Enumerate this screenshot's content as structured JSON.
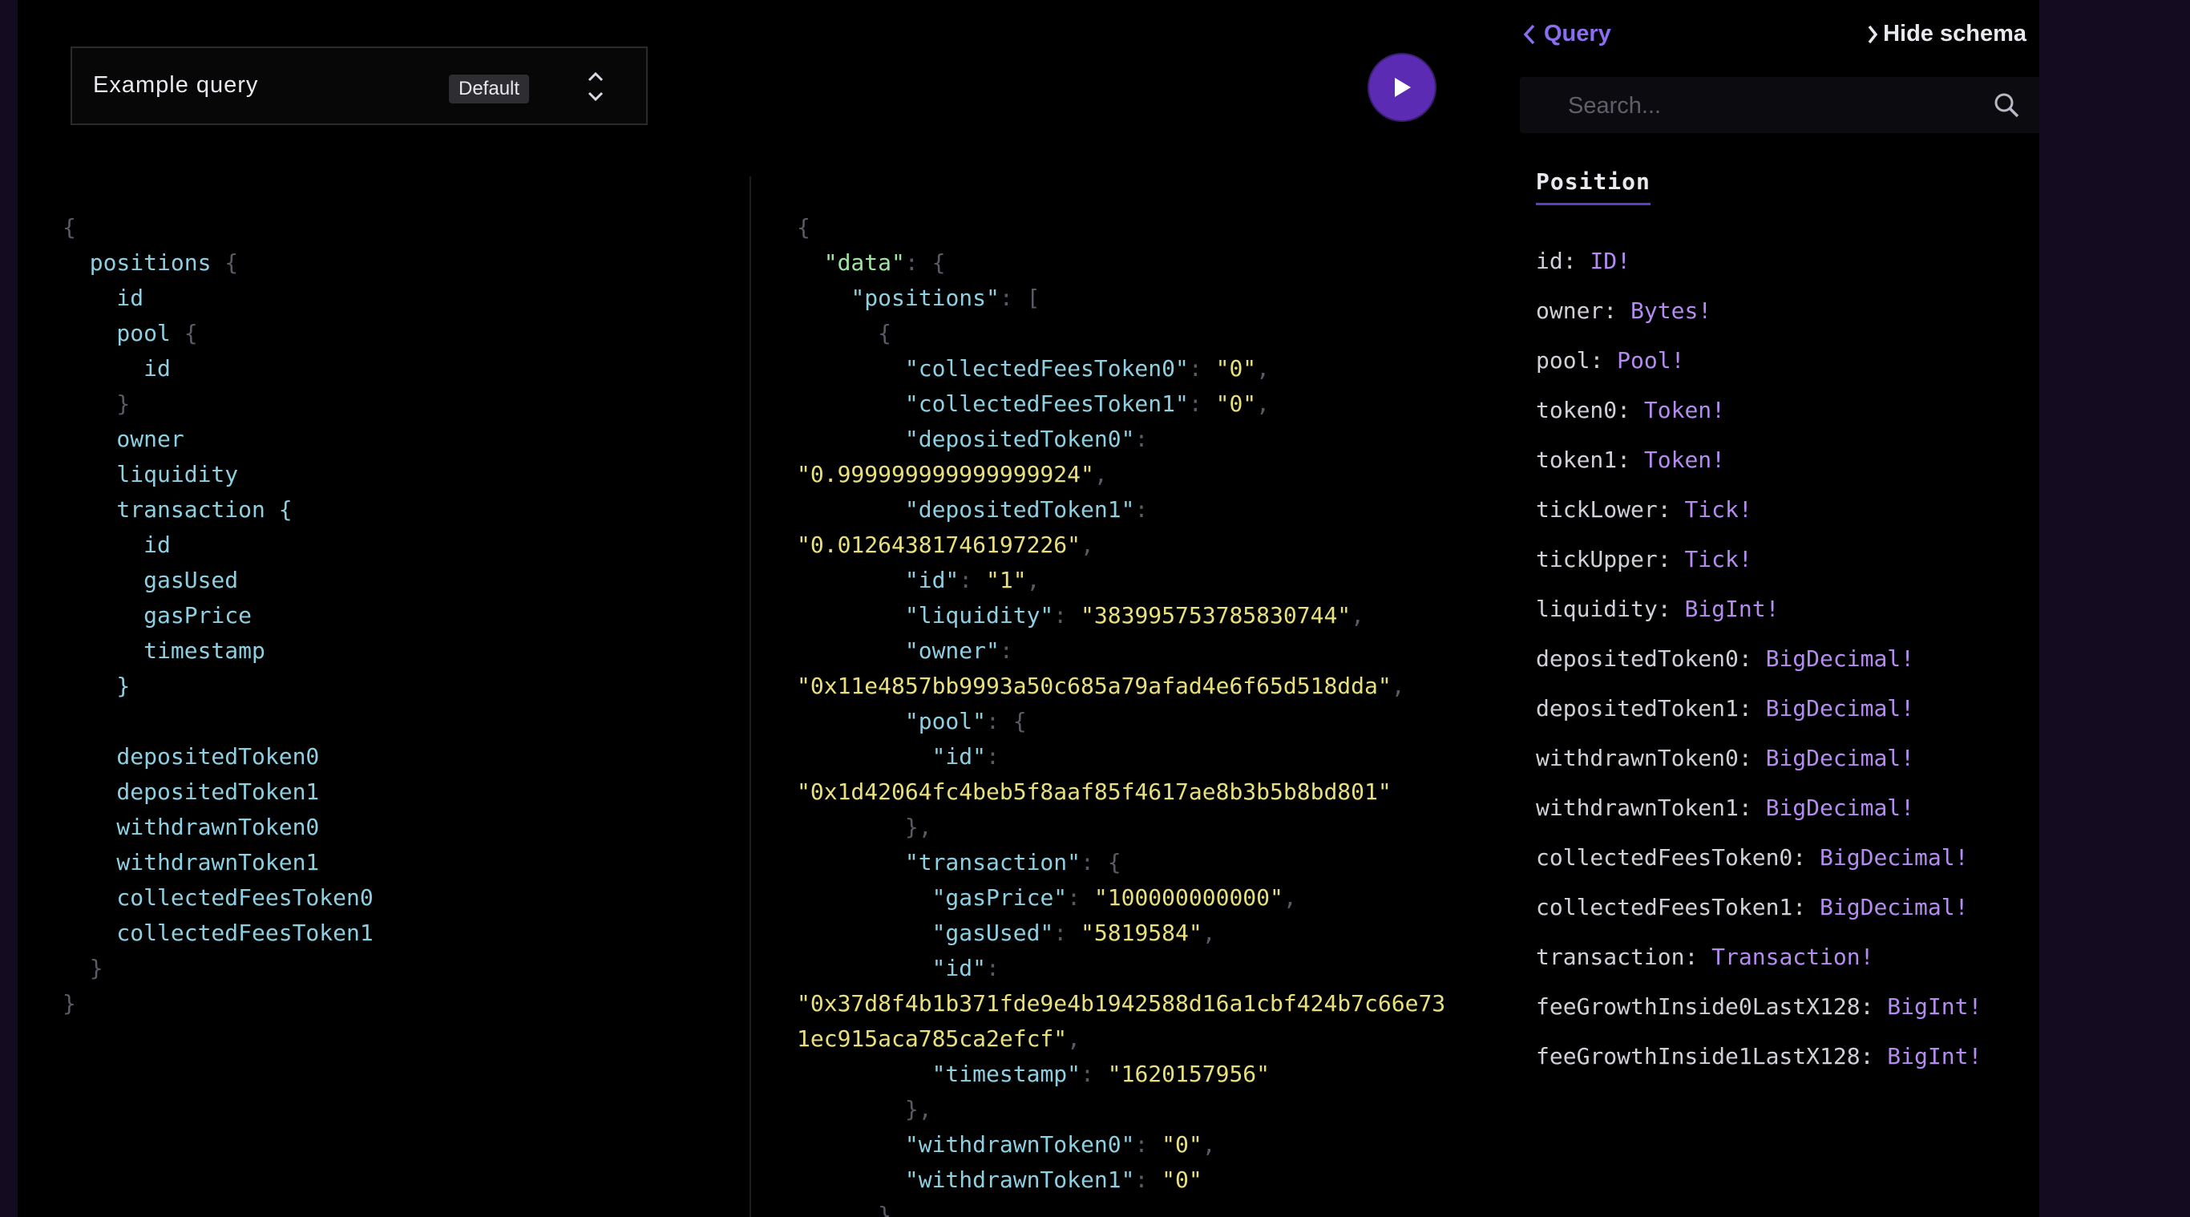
{
  "query_selector": {
    "name": "Example query",
    "badge": "Default"
  },
  "query_lines": [
    [
      {
        "t": "{",
        "c": "brace"
      }
    ],
    [
      {
        "t": "  positions ",
        "c": "field"
      },
      {
        "t": "{",
        "c": "brace"
      }
    ],
    [
      {
        "t": "    id",
        "c": "field"
      }
    ],
    [
      {
        "t": "    pool ",
        "c": "field"
      },
      {
        "t": "{",
        "c": "brace"
      }
    ],
    [
      {
        "t": "      id",
        "c": "field"
      }
    ],
    [
      {
        "t": "    }",
        "c": "brace"
      }
    ],
    [
      {
        "t": "    owner",
        "c": "field"
      }
    ],
    [
      {
        "t": "    liquidity",
        "c": "field"
      }
    ],
    [
      {
        "t": "    transaction ",
        "c": "field"
      },
      {
        "t": "{",
        "c": "field"
      }
    ],
    [
      {
        "t": "      id",
        "c": "field"
      }
    ],
    [
      {
        "t": "      gasUsed",
        "c": "field"
      }
    ],
    [
      {
        "t": "      gasPrice",
        "c": "field"
      }
    ],
    [
      {
        "t": "      timestamp",
        "c": "field"
      }
    ],
    [
      {
        "t": "    }",
        "c": "field"
      }
    ],
    [
      {
        "t": "",
        "c": "field"
      }
    ],
    [
      {
        "t": "    depositedToken0",
        "c": "field"
      }
    ],
    [
      {
        "t": "    depositedToken1",
        "c": "field"
      }
    ],
    [
      {
        "t": "    withdrawnToken0",
        "c": "field"
      }
    ],
    [
      {
        "t": "    withdrawnToken1",
        "c": "field"
      }
    ],
    [
      {
        "t": "    collectedFeesToken0",
        "c": "field"
      }
    ],
    [
      {
        "t": "    collectedFeesToken1",
        "c": "field"
      }
    ],
    [
      {
        "t": "  }",
        "c": "brace"
      }
    ],
    [
      {
        "t": "}",
        "c": "brace"
      }
    ]
  ],
  "result_lines": [
    [
      {
        "t": "{",
        "c": "punc"
      }
    ],
    [
      {
        "t": "  ",
        "c": "punc"
      },
      {
        "t": "\"data\"",
        "c": "topkey"
      },
      {
        "t": ": {",
        "c": "punc"
      }
    ],
    [
      {
        "t": "    ",
        "c": "punc"
      },
      {
        "t": "\"positions\"",
        "c": "key"
      },
      {
        "t": ": [",
        "c": "punc"
      }
    ],
    [
      {
        "t": "      {",
        "c": "punc"
      }
    ],
    [
      {
        "t": "        ",
        "c": "punc"
      },
      {
        "t": "\"collectedFeesToken0\"",
        "c": "key"
      },
      {
        "t": ": ",
        "c": "punc"
      },
      {
        "t": "\"0\"",
        "c": "str"
      },
      {
        "t": ",",
        "c": "punc"
      }
    ],
    [
      {
        "t": "        ",
        "c": "punc"
      },
      {
        "t": "\"collectedFeesToken1\"",
        "c": "key"
      },
      {
        "t": ": ",
        "c": "punc"
      },
      {
        "t": "\"0\"",
        "c": "str"
      },
      {
        "t": ",",
        "c": "punc"
      }
    ],
    [
      {
        "t": "        ",
        "c": "punc"
      },
      {
        "t": "\"depositedToken0\"",
        "c": "key"
      },
      {
        "t": ":",
        "c": "punc"
      }
    ],
    [
      {
        "t": "\"0.999999999999999924\"",
        "c": "str"
      },
      {
        "t": ",",
        "c": "punc"
      }
    ],
    [
      {
        "t": "        ",
        "c": "punc"
      },
      {
        "t": "\"depositedToken1\"",
        "c": "key"
      },
      {
        "t": ":",
        "c": "punc"
      }
    ],
    [
      {
        "t": "\"0.01264381746197226\"",
        "c": "str"
      },
      {
        "t": ",",
        "c": "punc"
      }
    ],
    [
      {
        "t": "        ",
        "c": "punc"
      },
      {
        "t": "\"id\"",
        "c": "key"
      },
      {
        "t": ": ",
        "c": "punc"
      },
      {
        "t": "\"1\"",
        "c": "str"
      },
      {
        "t": ",",
        "c": "punc"
      }
    ],
    [
      {
        "t": "        ",
        "c": "punc"
      },
      {
        "t": "\"liquidity\"",
        "c": "key"
      },
      {
        "t": ": ",
        "c": "punc"
      },
      {
        "t": "\"383995753785830744\"",
        "c": "str"
      },
      {
        "t": ",",
        "c": "punc"
      }
    ],
    [
      {
        "t": "        ",
        "c": "punc"
      },
      {
        "t": "\"owner\"",
        "c": "key"
      },
      {
        "t": ":",
        "c": "punc"
      }
    ],
    [
      {
        "t": "\"0x11e4857bb9993a50c685a79afad4e6f65d518dda\"",
        "c": "str"
      },
      {
        "t": ",",
        "c": "punc"
      }
    ],
    [
      {
        "t": "        ",
        "c": "punc"
      },
      {
        "t": "\"pool\"",
        "c": "key"
      },
      {
        "t": ": {",
        "c": "punc"
      }
    ],
    [
      {
        "t": "          ",
        "c": "punc"
      },
      {
        "t": "\"id\"",
        "c": "key"
      },
      {
        "t": ":",
        "c": "punc"
      }
    ],
    [
      {
        "t": "\"0x1d42064fc4beb5f8aaf85f4617ae8b3b5b8bd801\"",
        "c": "str"
      }
    ],
    [
      {
        "t": "        },",
        "c": "punc"
      }
    ],
    [
      {
        "t": "        ",
        "c": "punc"
      },
      {
        "t": "\"transaction\"",
        "c": "key"
      },
      {
        "t": ": {",
        "c": "punc"
      }
    ],
    [
      {
        "t": "          ",
        "c": "punc"
      },
      {
        "t": "\"gasPrice\"",
        "c": "key"
      },
      {
        "t": ": ",
        "c": "punc"
      },
      {
        "t": "\"100000000000\"",
        "c": "str"
      },
      {
        "t": ",",
        "c": "punc"
      }
    ],
    [
      {
        "t": "          ",
        "c": "punc"
      },
      {
        "t": "\"gasUsed\"",
        "c": "key"
      },
      {
        "t": ": ",
        "c": "punc"
      },
      {
        "t": "\"5819584\"",
        "c": "str"
      },
      {
        "t": ",",
        "c": "punc"
      }
    ],
    [
      {
        "t": "          ",
        "c": "punc"
      },
      {
        "t": "\"id\"",
        "c": "key"
      },
      {
        "t": ":",
        "c": "punc"
      }
    ],
    [
      {
        "t": "\"0x37d8f4b1b371fde9e4b1942588d16a1cbf424b7c66e73",
        "c": "str"
      }
    ],
    [
      {
        "t": "1ec915aca785ca2efcf\"",
        "c": "str"
      },
      {
        "t": ",",
        "c": "punc"
      }
    ],
    [
      {
        "t": "          ",
        "c": "punc"
      },
      {
        "t": "\"timestamp\"",
        "c": "key"
      },
      {
        "t": ": ",
        "c": "punc"
      },
      {
        "t": "\"1620157956\"",
        "c": "str"
      }
    ],
    [
      {
        "t": "        },",
        "c": "punc"
      }
    ],
    [
      {
        "t": "        ",
        "c": "punc"
      },
      {
        "t": "\"withdrawnToken0\"",
        "c": "key"
      },
      {
        "t": ": ",
        "c": "punc"
      },
      {
        "t": "\"0\"",
        "c": "str"
      },
      {
        "t": ",",
        "c": "punc"
      }
    ],
    [
      {
        "t": "        ",
        "c": "punc"
      },
      {
        "t": "\"withdrawnToken1\"",
        "c": "key"
      },
      {
        "t": ": ",
        "c": "punc"
      },
      {
        "t": "\"0\"",
        "c": "str"
      }
    ],
    [
      {
        "t": "      }",
        "c": "punc"
      }
    ]
  ],
  "schema": {
    "back_label": "Query",
    "hide_label": "Hide schema",
    "search_placeholder": "Search...",
    "type_name": "Position",
    "fields": [
      {
        "name": "id",
        "type": "ID!"
      },
      {
        "name": "owner",
        "type": "Bytes!"
      },
      {
        "name": "pool",
        "type": "Pool!"
      },
      {
        "name": "token0",
        "type": "Token!"
      },
      {
        "name": "token1",
        "type": "Token!"
      },
      {
        "name": "tickLower",
        "type": "Tick!"
      },
      {
        "name": "tickUpper",
        "type": "Tick!"
      },
      {
        "name": "liquidity",
        "type": "BigInt!"
      },
      {
        "name": "depositedToken0",
        "type": "BigDecimal!"
      },
      {
        "name": "depositedToken1",
        "type": "BigDecimal!"
      },
      {
        "name": "withdrawnToken0",
        "type": "BigDecimal!"
      },
      {
        "name": "withdrawnToken1",
        "type": "BigDecimal!"
      },
      {
        "name": "collectedFeesToken0",
        "type": "BigDecimal!"
      },
      {
        "name": "collectedFeesToken1",
        "type": "BigDecimal!"
      },
      {
        "name": "transaction",
        "type": "Transaction!"
      },
      {
        "name": "feeGrowthInside0LastX128",
        "type": "BigInt!"
      },
      {
        "name": "feeGrowthInside1LastX128",
        "type": "BigInt!"
      }
    ]
  },
  "colors": {
    "accent": "#5b2bb4",
    "link": "#8b6ef0",
    "type": "#b48cf0",
    "string": "#e9e07d",
    "field": "#8ecfe2"
  },
  "icons": {
    "run": "play-icon",
    "back": "chevron-left-icon",
    "hide": "chevron-right-icon",
    "search": "search-icon",
    "sort": "sort-icon"
  }
}
